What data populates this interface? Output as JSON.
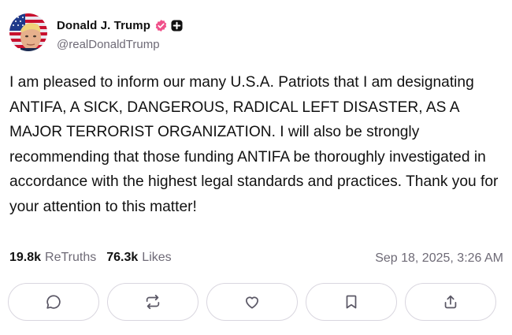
{
  "author": {
    "display_name": "Donald J. Trump",
    "handle": "@realDonaldTrump",
    "verified_badge_color": "#f0508a",
    "plus_badge_color": "#111111"
  },
  "post": {
    "text": "I am pleased to inform our many U.S.A. Patriots that I am designating ANTIFA, A SICK, DANGEROUS, RADICAL LEFT DISASTER, AS A MAJOR TERRORIST ORGANIZATION. I will also be strongly recommending that those funding ANTIFA be thoroughly investigated in accordance with the highest legal standards and practices. Thank you for your attention to this matter!"
  },
  "stats": {
    "retruths_count": "19.8k",
    "retruths_label": "ReTruths",
    "likes_count": "76.3k",
    "likes_label": "Likes",
    "timestamp": "Sep 18, 2025, 3:26 AM"
  },
  "actions": [
    {
      "icon": "comment-icon"
    },
    {
      "icon": "retruth-icon"
    },
    {
      "icon": "heart-icon"
    },
    {
      "icon": "bookmark-icon"
    },
    {
      "icon": "share-icon"
    }
  ],
  "colors": {
    "text": "#111111",
    "muted": "#6e6a76",
    "border": "#d9d6df",
    "icon": "#5b5866"
  }
}
